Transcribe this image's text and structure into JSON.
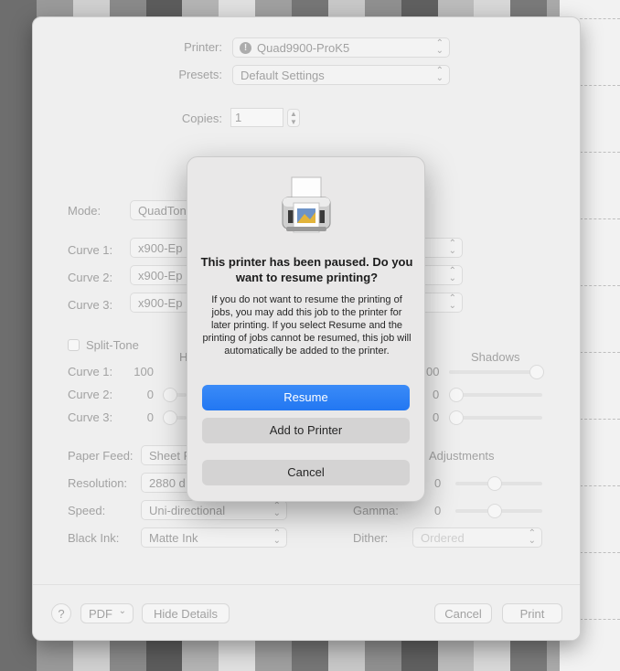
{
  "colors": {
    "accent": "#2277f2",
    "background_strips": [
      "#6e6e6e",
      "#9a9a9a",
      "#d0d0d0",
      "#8a8a8a",
      "#5c5c5c",
      "#b4b4b4",
      "#e0e0e0",
      "#a0a0a0",
      "#767676",
      "#c8c8c8",
      "#909090",
      "#606060",
      "#bcbcbc",
      "#d8d8d8",
      "#7a7a7a",
      "#aaaaaa",
      "#858585"
    ]
  },
  "print_dialog": {
    "printer_label": "Printer:",
    "printer_value": "Quad9900-ProK5",
    "presets_label": "Presets:",
    "presets_value": "Default Settings",
    "copies_label": "Copies:",
    "copies_value": "1",
    "mode_label": "Mode:",
    "mode_value": "QuadTon",
    "curve1_label": "Curve 1:",
    "curve1_value": "x900-Ep",
    "curve2_label": "Curve 2:",
    "curve2_value": "x900-Ep",
    "curve3_label": "Curve 3:",
    "curve3_value": "x900-Ep",
    "split_tone_label": "Split-Tone",
    "highlights_partial": "H",
    "shadows_label": "Shadows",
    "split_curve1_label": "Curve 1:",
    "split_curve1_value": "100",
    "split_curve1_right": "00",
    "split_curve2_label": "Curve 2:",
    "split_curve2_value": "0",
    "split_curve2_right": "0",
    "split_curve3_label": "Curve 3:",
    "split_curve3_value": "0",
    "split_curve3_right": "0",
    "paper_feed_label": "Paper Feed:",
    "paper_feed_value": "Sheet F",
    "adjustments_label": "Adjustments",
    "resolution_label": "Resolution:",
    "resolution_value": "2880 d",
    "adjust_value_1": "0",
    "speed_label": "Speed:",
    "speed_value": "Uni-directional",
    "gamma_label": "Gamma:",
    "gamma_value": "0",
    "black_ink_label": "Black Ink:",
    "black_ink_value": "Matte Ink",
    "dither_label": "Dither:",
    "dither_value": "Ordered",
    "help_label": "?",
    "pdf_label": "PDF",
    "hide_details_label": "Hide Details",
    "cancel_label": "Cancel",
    "print_label": "Print"
  },
  "alert": {
    "title": "This printer has been paused. Do you want to resume printing?",
    "message": "If you do not want to resume the printing of jobs, you may add this job to the printer for later printing. If you select Resume and the printing of jobs cannot be resumed, this job will automatically be added to the printer.",
    "resume_label": "Resume",
    "add_to_printer_label": "Add to Printer",
    "cancel_label": "Cancel"
  }
}
